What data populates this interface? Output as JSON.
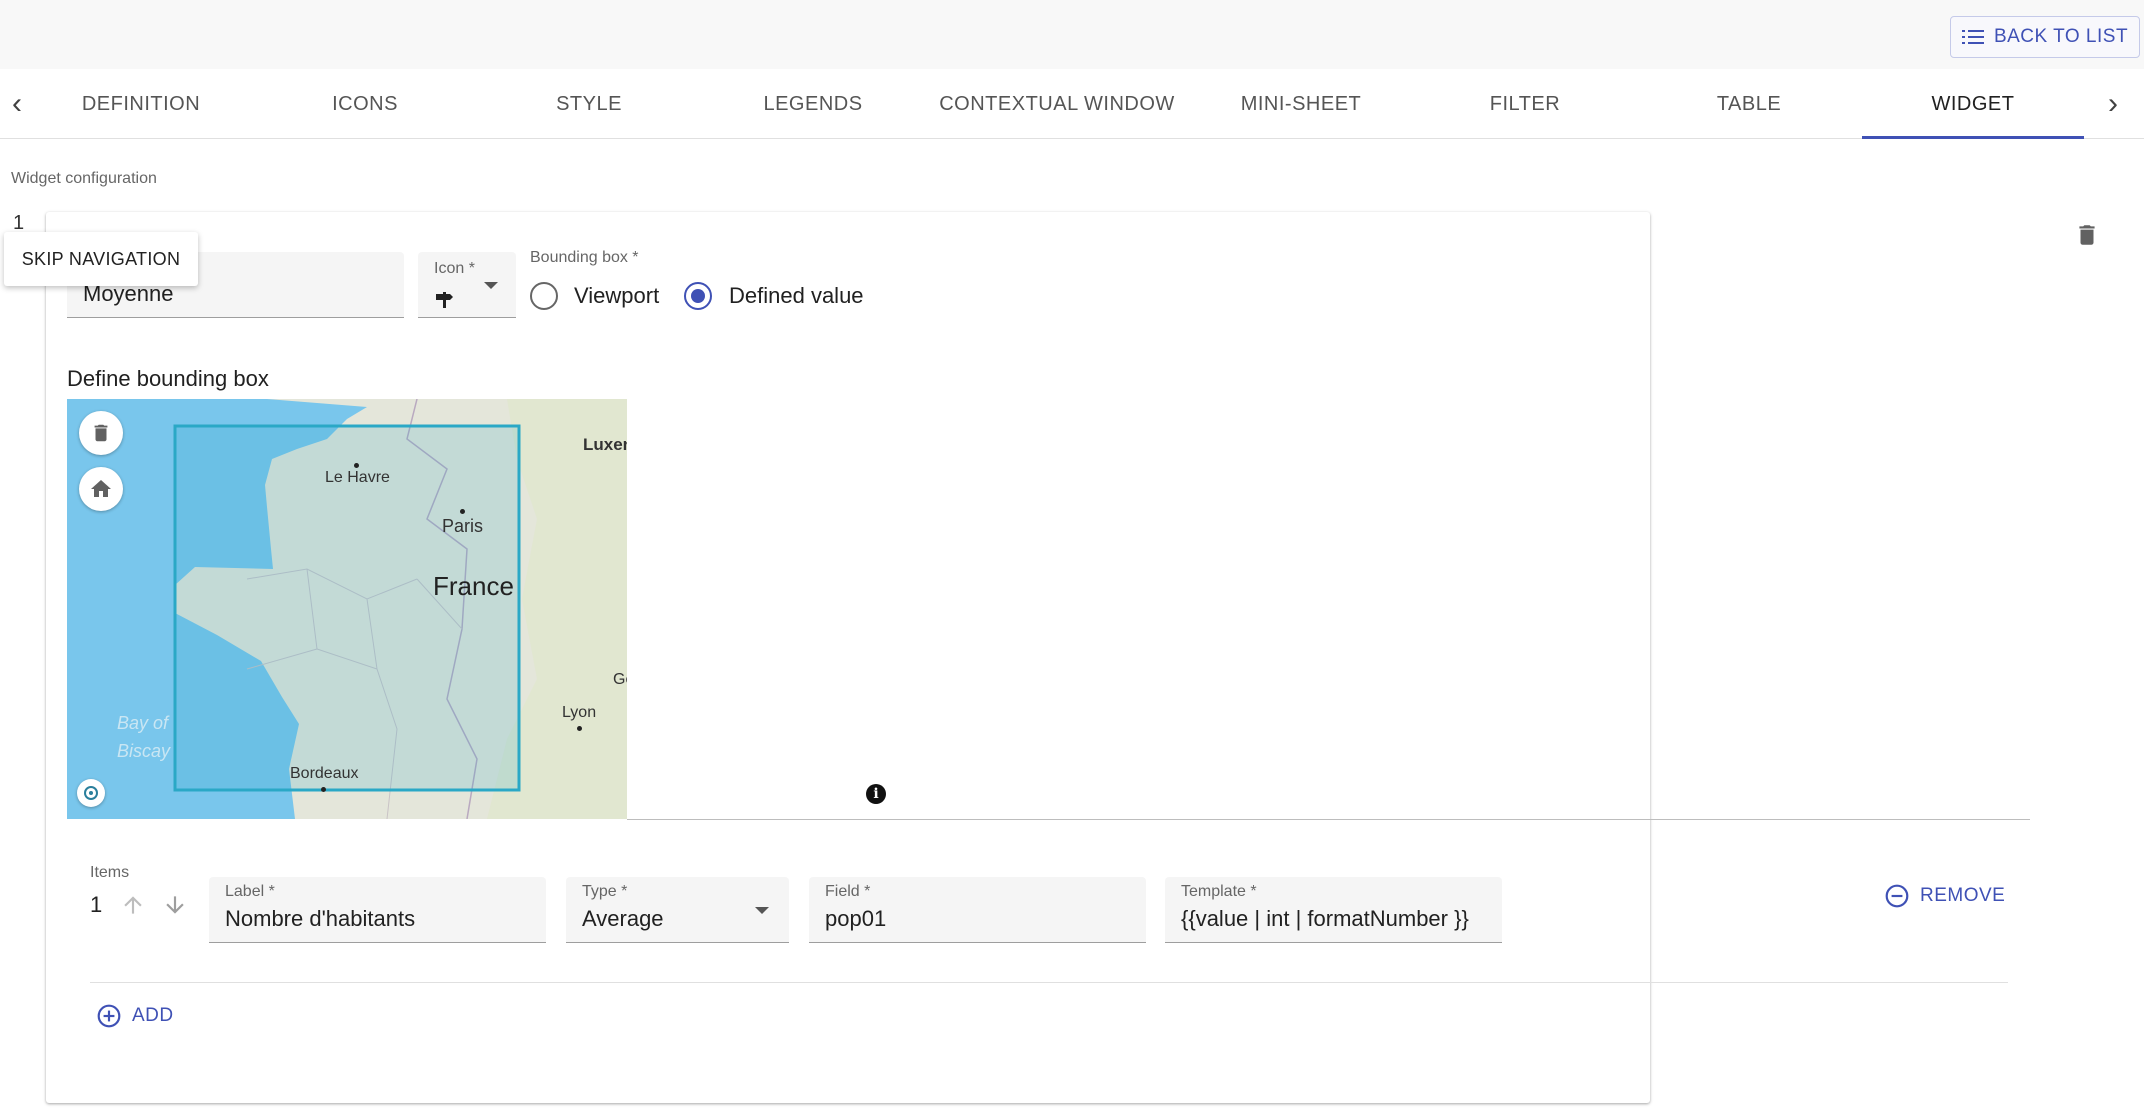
{
  "header": {
    "back_label": "BACK TO LIST",
    "back_icon": "list-icon"
  },
  "tabs": [
    {
      "label": "DEFINITION"
    },
    {
      "label": "ICONS"
    },
    {
      "label": "STYLE"
    },
    {
      "label": "LEGENDS"
    },
    {
      "label": "CONTEXTUAL WINDOW"
    },
    {
      "label": "MINI-SHEET"
    },
    {
      "label": "FILTER"
    },
    {
      "label": "TABLE"
    },
    {
      "label": "WIDGET",
      "active": true
    }
  ],
  "widget_config": {
    "caption": "Widget configuration",
    "index": "1",
    "skip_navigation": "SKIP NAVIGATION",
    "title_value": "Moyenne",
    "icon_label": "Icon *",
    "bounding_box_label": "Bounding box *",
    "radio_options": [
      {
        "label": "Viewport",
        "checked": false
      },
      {
        "label": "Defined value",
        "checked": true
      }
    ],
    "define_title": "Define bounding box"
  },
  "map": {
    "labels": {
      "le_havre": "Le Havre",
      "paris": "Paris",
      "france": "France",
      "lyon": "Lyon",
      "bordeaux": "Bordeaux",
      "luxembourg": "Luxen",
      "geneve": "Ge",
      "bay1": "Bay of",
      "bay2": "Biscay"
    },
    "colors": {
      "sea": "#79c6ec",
      "land": "#e4e6da",
      "bbox": "#2aa8c6"
    }
  },
  "items": {
    "caption": "Items",
    "rows": [
      {
        "index": "1",
        "label_label": "Label *",
        "label_value": "Nombre d'habitants",
        "type_label": "Type *",
        "type_value": "Average",
        "field_label": "Field *",
        "field_value": "pop01",
        "template_label": "Template *",
        "template_value": "{{value | int | formatNumber }}"
      }
    ],
    "remove_label": "REMOVE",
    "add_label": "ADD"
  },
  "colors": {
    "accent": "#3f51b5"
  }
}
